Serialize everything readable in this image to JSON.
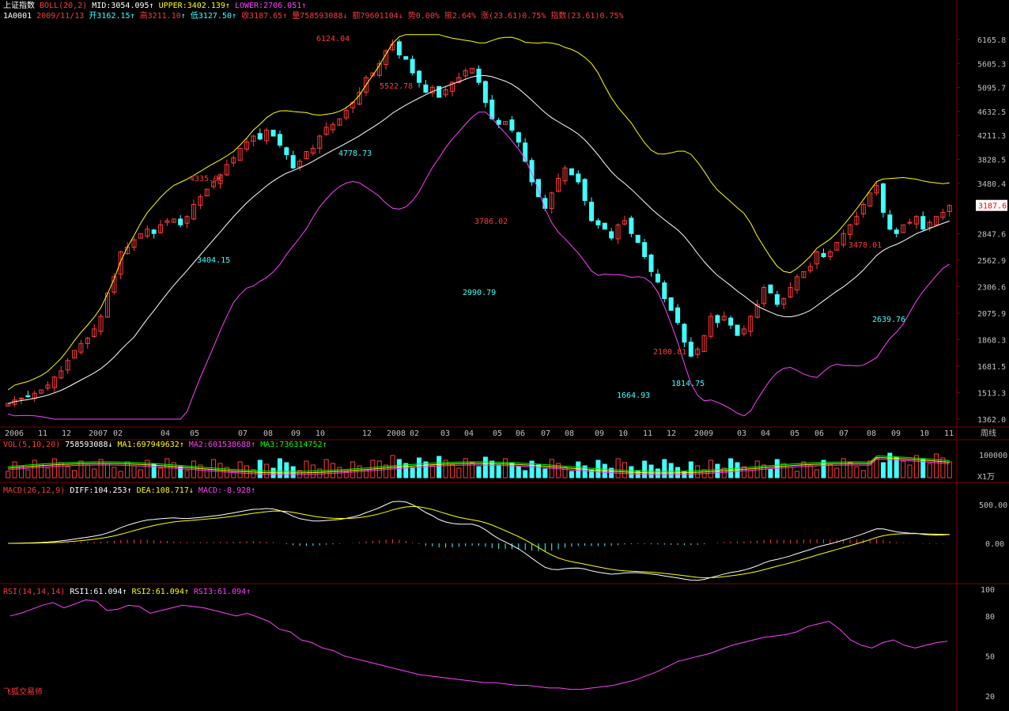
{
  "header": {
    "index_name": "上证指数",
    "boll_label": "BOLL(20,2)",
    "mid": "MID:3054.095",
    "upper": "UPPER:3402.139",
    "lower": "LOWER:2706.051",
    "code": "1A0001",
    "date": "2009/11/13",
    "open": "开3162.15",
    "high": "高3211.10",
    "low": "低3127.50",
    "close": "收3187.65",
    "volume": "量758593088",
    "amount": "额79601104",
    "change": "势0.00%",
    "amplitude": "振2.64%",
    "rise": "涨(23.61)0.75%",
    "index_chg": "指数(23.61)0.75%"
  },
  "vol_header": {
    "label": "VOL(5,10,20)",
    "v": "758593088",
    "ma1": "MA1:697949632",
    "ma2": "MA2:601538688",
    "ma3": "MA3:736314752"
  },
  "macd_header": {
    "label": "MACD(26,12,9)",
    "diff": "DIFF:104.253",
    "dea": "DEA:108.717",
    "macd": "MACD:-8.928"
  },
  "rsi_header": {
    "label": "RSI(14,14,14)",
    "rsi1": "RSI1:61.094",
    "rsi2": "RSI2:61.094",
    "rsi3": "RSI3:61.094"
  },
  "watermark": "飞狐交易师",
  "period_label": "周线",
  "vol_unit": "X1万",
  "price_tag": "3187.6",
  "colors": {
    "up": "#ff3b3b",
    "down": "#40ffff",
    "mid": "#ffffff",
    "upper": "#ffff00",
    "lower": "#ff40ff",
    "grid": "#800000"
  },
  "chart_data": [
    {
      "type": "candlestick",
      "title": "上证指数 weekly",
      "price_axis_ticks": [
        6165.8,
        5605.3,
        5095.7,
        4632.5,
        4211.3,
        3828.5,
        3480.4,
        2847.6,
        2562.9,
        2306.6,
        2075.9,
        1868.3,
        1681.5,
        1513.3,
        1362.0
      ],
      "ylim": [
        1362.0,
        6165.8
      ],
      "time_axis_labels": [
        "2006",
        "11",
        "12",
        "2007",
        "02",
        "04",
        "05",
        "07",
        "08",
        "09",
        "10",
        "12",
        "2008",
        "02",
        "03",
        "04",
        "05",
        "06",
        "07",
        "08",
        "09",
        "10",
        "11",
        "12",
        "2009",
        "03",
        "04",
        "05",
        "06",
        "07",
        "08",
        "09",
        "10",
        "11"
      ],
      "annotations": [
        "6124.04",
        "5522.78",
        "4335.96",
        "4778.73",
        "3404.15",
        "3786.02",
        "2990.79",
        "3478.01",
        "2100.81",
        "1814.75",
        "1664.93",
        "2639.76"
      ],
      "close_series": [
        1450,
        1470,
        1480,
        1490,
        1510,
        1530,
        1560,
        1610,
        1650,
        1720,
        1790,
        1840,
        1880,
        1950,
        2050,
        2250,
        2400,
        2650,
        2700,
        2780,
        2850,
        2900,
        2850,
        2950,
        3000,
        3020,
        2950,
        3050,
        3200,
        3300,
        3400,
        3500,
        3600,
        3750,
        3850,
        4000,
        4100,
        4200,
        4150,
        4300,
        4200,
        4050,
        3900,
        3700,
        3800,
        3950,
        4000,
        4200,
        4350,
        4400,
        4500,
        4650,
        4800,
        5000,
        5300,
        5400,
        5600,
        5900,
        6050,
        5800,
        5700,
        5400,
        5200,
        5000,
        5100,
        4900,
        5050,
        5200,
        5300,
        5450,
        5500,
        5200,
        4800,
        4500,
        4400,
        4450,
        4300,
        4100,
        3800,
        3500,
        3300,
        3150,
        3350,
        3550,
        3700,
        3600,
        3500,
        3250,
        3000,
        2950,
        2900,
        2800,
        2950,
        3000,
        2850,
        2750,
        2600,
        2450,
        2350,
        2200,
        2100,
        2000,
        1850,
        1750,
        1800,
        1900,
        2050,
        2000,
        2050,
        1980,
        1900,
        1950,
        2050,
        2150,
        2300,
        2250,
        2150,
        2200,
        2300,
        2400,
        2450,
        2500,
        2650,
        2600,
        2650,
        2750,
        2850,
        2950,
        3050,
        3200,
        3350,
        3450,
        3100,
        2900,
        2850,
        2950,
        2980,
        3050,
        2900,
        2980,
        3050,
        3100,
        3187
      ]
    },
    {
      "type": "bar",
      "title": "VOL(5,10,20)",
      "ylabel": "X1万",
      "y_ticks": [
        100000
      ]
    },
    {
      "type": "line",
      "title": "MACD(26,12,9)",
      "y_ticks": [
        500.0,
        0.0
      ],
      "series": [
        {
          "name": "DIFF"
        },
        {
          "name": "DEA"
        },
        {
          "name": "MACD"
        }
      ]
    },
    {
      "type": "line",
      "title": "RSI(14,14,14)",
      "y_ticks": [
        100,
        80,
        50,
        20
      ],
      "ylim": [
        20,
        100
      ],
      "series": [
        {
          "name": "RSI1",
          "values": [
            80,
            82,
            85,
            88,
            90,
            86,
            89,
            92,
            91,
            84,
            85,
            88,
            87,
            82,
            84,
            86,
            88,
            87,
            86,
            84,
            82,
            80,
            82,
            79,
            76,
            70,
            68,
            62,
            60,
            56,
            54,
            50,
            48,
            46,
            44,
            42,
            40,
            38,
            36,
            35,
            34,
            33,
            32,
            31,
            30,
            30,
            29,
            28,
            28,
            27,
            26,
            26,
            25,
            25,
            26,
            27,
            28,
            30,
            32,
            35,
            38,
            42,
            46,
            48,
            50,
            52,
            55,
            58,
            60,
            62,
            64,
            65,
            66,
            68,
            72,
            74,
            76,
            70,
            62,
            58,
            56,
            60,
            62,
            58,
            56,
            58,
            60,
            61
          ]
        }
      ]
    }
  ]
}
